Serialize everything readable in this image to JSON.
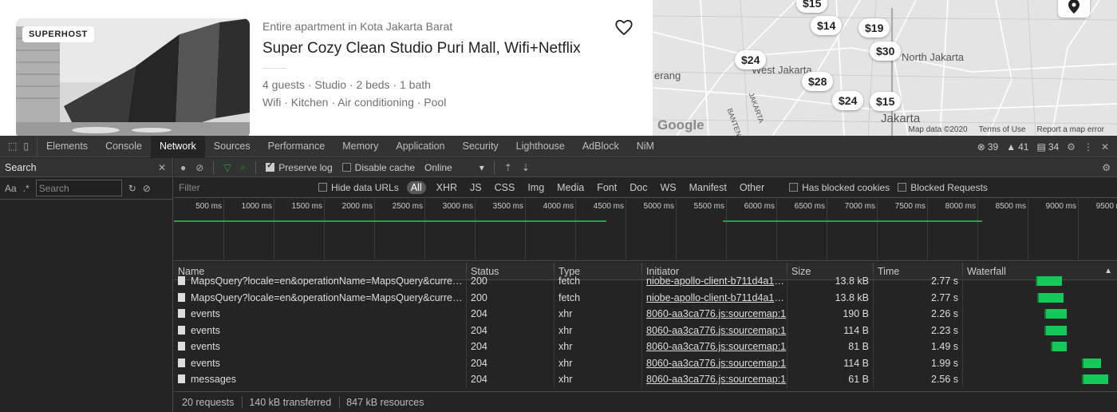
{
  "listing": {
    "badge": "SUPERHOST",
    "subtitle": "Entire apartment in Kota Jakarta Barat",
    "title": "Super Cozy Clean Studio Puri Mall, Wifi+Netflix",
    "details": "4 guests · Studio · 2 beds · 1 bath",
    "amenities": "Wifi · Kitchen · Air conditioning · Pool"
  },
  "map": {
    "labels": [
      "West Jakarta",
      "North Jakarta",
      "Jakarta",
      "erang",
      "JAKARTA",
      "BANTEN"
    ],
    "pins": [
      "$15",
      "$14",
      "$19",
      "$30",
      "$24",
      "$28",
      "$24",
      "$15"
    ],
    "google": "Google",
    "footer": [
      "Map data ©2020",
      "Terms of Use",
      "Report a map error"
    ]
  },
  "devtools": {
    "tabs": [
      "Elements",
      "Console",
      "Network",
      "Sources",
      "Performance",
      "Memory",
      "Application",
      "Security",
      "Lighthouse",
      "AdBlock",
      "NiM"
    ],
    "counts": {
      "errors": "39",
      "warnings": "41",
      "info": "34"
    },
    "search": {
      "title": "Search",
      "case_label": "Aa",
      "regex_label": ".*",
      "placeholder": "Search"
    },
    "toolbar": {
      "preserve_log": "Preserve log",
      "disable_cache": "Disable cache",
      "throttle": "Online"
    },
    "filter": {
      "placeholder": "Filter",
      "hide_data_urls": "Hide data URLs",
      "types": [
        "All",
        "XHR",
        "JS",
        "CSS",
        "Img",
        "Media",
        "Font",
        "Doc",
        "WS",
        "Manifest",
        "Other"
      ],
      "blocked_cookies": "Has blocked cookies",
      "blocked_requests": "Blocked Requests"
    },
    "overview_ticks": [
      "500 ms",
      "1000 ms",
      "1500 ms",
      "2000 ms",
      "2500 ms",
      "3000 ms",
      "3500 ms",
      "4000 ms",
      "4500 ms",
      "5000 ms",
      "5500 ms",
      "6000 ms",
      "6500 ms",
      "7000 ms",
      "7500 ms",
      "8000 ms",
      "8500 ms",
      "9000 ms",
      "9500 ms"
    ],
    "columns": [
      "Name",
      "Status",
      "Type",
      "Initiator",
      "Size",
      "Time",
      "Waterfall"
    ],
    "rows": [
      {
        "name": "MapsQuery?locale=en&operationName=MapsQuery&curren.....",
        "status": "200",
        "type": "fetch",
        "initiator": "niobe-apollo-client-b711d4a1.j...",
        "size": "13.8 kB",
        "time": "2.77 s",
        "wf_start": 0.52,
        "wf_len": 0.19
      },
      {
        "name": "MapsQuery?locale=en&operationName=MapsQuery&curren.....",
        "status": "200",
        "type": "fetch",
        "initiator": "niobe-apollo-client-b711d4a1.j...",
        "size": "13.8 kB",
        "time": "2.77 s",
        "wf_start": 0.53,
        "wf_len": 0.19
      },
      {
        "name": "events",
        "status": "204",
        "type": "xhr",
        "initiator": "8060-aa3ca776.js:sourcemap:1",
        "size": "190 B",
        "time": "2.26 s",
        "wf_start": 0.58,
        "wf_len": 0.16
      },
      {
        "name": "events",
        "status": "204",
        "type": "xhr",
        "initiator": "8060-aa3ca776.js:sourcemap:1",
        "size": "114 B",
        "time": "2.23 s",
        "wf_start": 0.58,
        "wf_len": 0.16
      },
      {
        "name": "events",
        "status": "204",
        "type": "xhr",
        "initiator": "8060-aa3ca776.js:sourcemap:1",
        "size": "81 B",
        "time": "1.49 s",
        "wf_start": 0.63,
        "wf_len": 0.11
      },
      {
        "name": "events",
        "status": "204",
        "type": "xhr",
        "initiator": "8060-aa3ca776.js:sourcemap:1",
        "size": "114 B",
        "time": "1.99 s",
        "wf_start": 0.85,
        "wf_len": 0.14
      },
      {
        "name": "messages",
        "status": "204",
        "type": "xhr",
        "initiator": "8060-aa3ca776.js:sourcemap:1",
        "size": "61 B",
        "time": "2.56 s",
        "wf_start": 0.85,
        "wf_len": 0.19
      }
    ],
    "status_bar": {
      "requests": "20 requests",
      "transferred": "140 kB transferred",
      "resources": "847 kB resources"
    },
    "colors": {
      "waterfall": "#14c85a",
      "timeline": "#1ea446"
    }
  }
}
